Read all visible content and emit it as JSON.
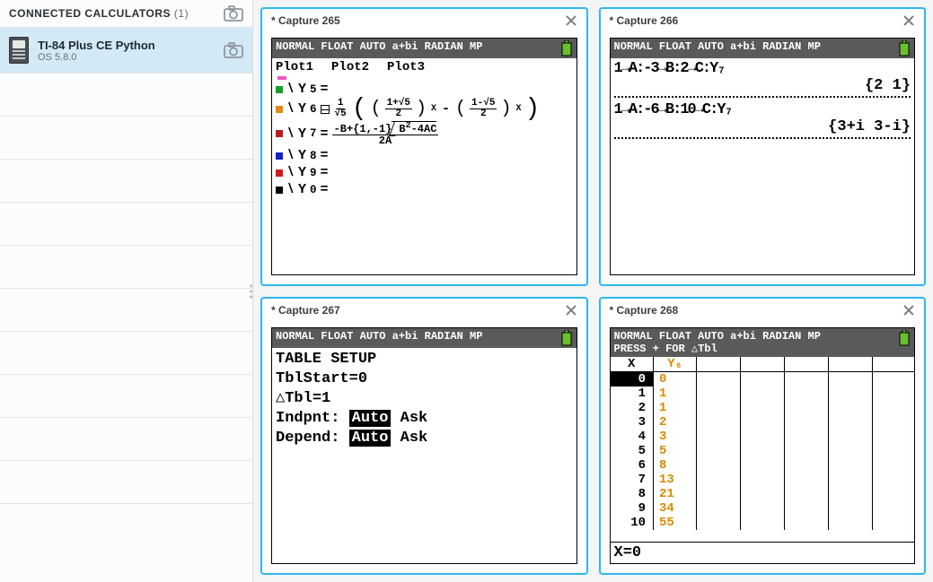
{
  "sidebar": {
    "header_label": "CONNECTED CALCULATORS",
    "count": "(1)",
    "device": {
      "name": "TI-84 Plus CE Python",
      "os": "OS 5.8.0"
    }
  },
  "status_line": "NORMAL FLOAT AUTO a+bi RADIAN MP",
  "cards": {
    "c265": {
      "title": "* Capture 265",
      "plots": [
        "Plot1",
        "Plot2",
        "Plot3"
      ],
      "y5_label": "Y",
      "y5_sub": "5",
      "y5_eq": "=",
      "y6_label": "Y",
      "y6_sub": "6",
      "y6": {
        "f1_top": "1",
        "f1_bot": "√5",
        "f2_top": "1+√5",
        "f2_bot": "2",
        "f3_top": "1-√5",
        "f3_bot": "2",
        "exp": "X"
      },
      "y7_label": "Y",
      "y7_sub": "7",
      "y7": {
        "top_a": "-B+{1,-1}",
        "top_b": "B",
        "top_c": "-4AC",
        "bot": "2A",
        "sq": "2"
      },
      "y8_label": "Y",
      "y8_sub": "8",
      "y8_eq": "=",
      "y9_label": "Y",
      "y9_sub": "9",
      "y9_eq": "=",
      "y0_label": "Y",
      "y0_sub": "0",
      "y0_eq": "="
    },
    "c266": {
      "title": "* Capture 266",
      "line1": "1→A:-3→B:2→C:Y₇",
      "out1": "{2 1}",
      "line2": "1→A:-6→B:10→C:Y₇",
      "out2": "{3+i 3-i}"
    },
    "c267": {
      "title": "* Capture 267",
      "l1": "TABLE SETUP",
      "l2": " TblStart=0",
      "l3": " △Tbl=1",
      "l4a": "Indpnt: ",
      "l4b": "Auto",
      "l4c": " Ask",
      "l5a": "Depend: ",
      "l5b": "Auto",
      "l5c": " Ask"
    },
    "c268": {
      "title": "* Capture 268",
      "status2": "PRESS + FOR △Tbl",
      "xh": "X",
      "y6h": "Y₆",
      "rows": [
        {
          "x": "0",
          "y": "0",
          "sel": true
        },
        {
          "x": "1",
          "y": "1"
        },
        {
          "x": "2",
          "y": "1"
        },
        {
          "x": "3",
          "y": "2"
        },
        {
          "x": "4",
          "y": "3"
        },
        {
          "x": "5",
          "y": "5"
        },
        {
          "x": "6",
          "y": "8"
        },
        {
          "x": "7",
          "y": "13"
        },
        {
          "x": "8",
          "y": "21"
        },
        {
          "x": "9",
          "y": "34"
        },
        {
          "x": "10",
          "y": "55"
        }
      ],
      "statusline": "X=0"
    }
  },
  "chart_data": {
    "type": "table",
    "title": "Fibonacci sequence Y₆ = (((1+√5)/2)^X - ((1-√5)/2)^X)/√5",
    "columns": [
      "X",
      "Y6"
    ],
    "rows": [
      [
        0,
        0
      ],
      [
        1,
        1
      ],
      [
        2,
        1
      ],
      [
        3,
        2
      ],
      [
        4,
        3
      ],
      [
        5,
        5
      ],
      [
        6,
        8
      ],
      [
        7,
        13
      ],
      [
        8,
        21
      ],
      [
        9,
        34
      ],
      [
        10,
        55
      ]
    ]
  }
}
